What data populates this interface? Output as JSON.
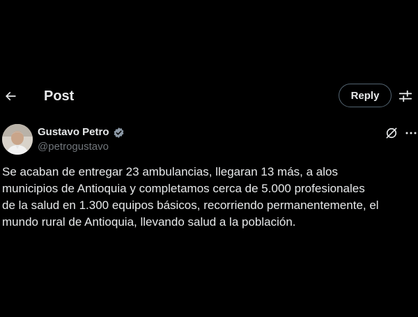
{
  "header": {
    "title": "Post",
    "reply_label": "Reply"
  },
  "author": {
    "name": "Gustavo Petro",
    "handle": "@petrogustavo",
    "verified": true
  },
  "tweet": {
    "lines": [
      "Se acaban de entregar 23 ambulancias, llegaran 13 más, a alos",
      "municipios de Antioquia y completamos cerca de 5.000 profesionales",
      "de la salud en 1.300 equipos básicos, recorriendo permanentemente, el",
      "mundo rural de Antioquia, llevando salud a la población."
    ]
  },
  "icons": {
    "back": "arrow-left-icon",
    "filter": "sliders-icon",
    "verified": "verified-badge-icon",
    "grok": "grok-icon",
    "more": "more-dots-icon"
  },
  "colors": {
    "background": "#000000",
    "text": "#e7e9ea",
    "secondary_text": "#71767b",
    "border": "#536471",
    "verified_badge": "#8b98a5"
  }
}
